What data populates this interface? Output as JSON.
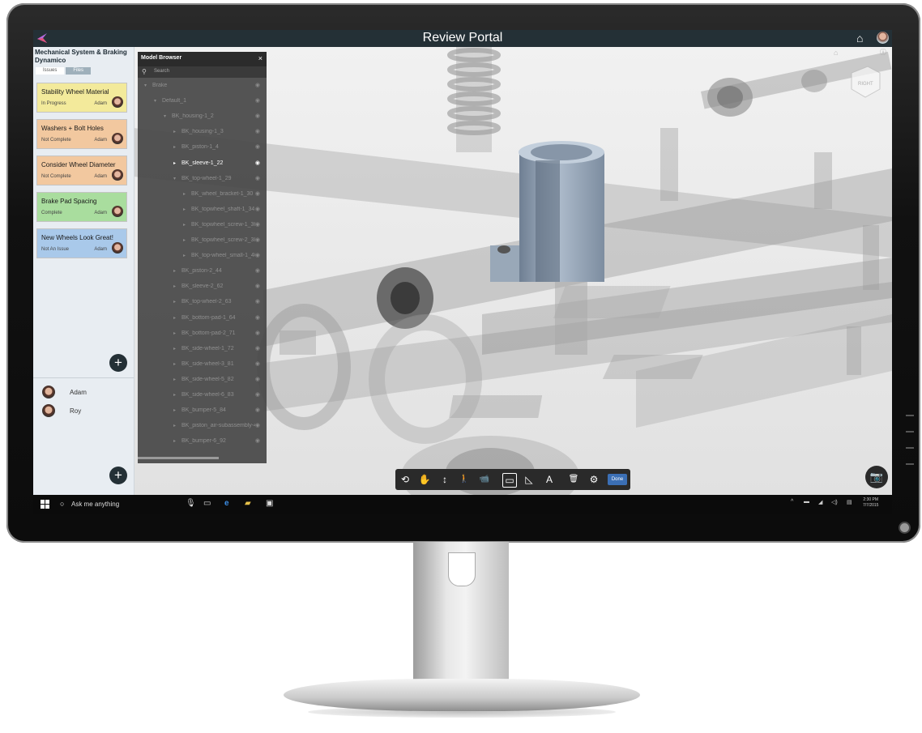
{
  "app": {
    "title": "Review Portal",
    "home_icon": "home-icon",
    "user_avatar": "user-avatar"
  },
  "project": {
    "title": "Mechanical System & Braking Dynamico",
    "tabs": [
      {
        "label": "Issues",
        "active": true
      },
      {
        "label": "Files",
        "active": false
      }
    ]
  },
  "issues": [
    {
      "title": "Stability Wheel Material",
      "status": "In Progress",
      "user": "Adam",
      "color": "#f3ea9b"
    },
    {
      "title": "Washers + Bolt Holes",
      "status": "Not Complete",
      "user": "Adam",
      "color": "#f2c89f"
    },
    {
      "title": "Consider Wheel Diameter",
      "status": "Not Complete",
      "user": "Adam",
      "color": "#f2c89f"
    },
    {
      "title": "Brake Pad Spacing",
      "status": "Complete",
      "user": "Adam",
      "color": "#a9dd9e"
    },
    {
      "title": "New Wheels Look Great!",
      "status": "Not An Issue",
      "user": "Adam",
      "color": "#a9c9ea"
    }
  ],
  "people": [
    {
      "name": "Adam"
    },
    {
      "name": "Roy"
    }
  ],
  "model_browser": {
    "title": "Model Browser",
    "close": "×",
    "search_placeholder": "Search",
    "rows": [
      {
        "label": "Brake",
        "level": 0,
        "arrow": "▾",
        "highlight": false
      },
      {
        "label": "Default_1",
        "level": 1,
        "arrow": "▾",
        "highlight": false
      },
      {
        "label": "BK_housing-1_2",
        "level": 2,
        "arrow": "▾",
        "highlight": false
      },
      {
        "label": "BK_housing-1_3",
        "level": 3,
        "arrow": "▸",
        "highlight": false
      },
      {
        "label": "BK_piston-1_4",
        "level": 3,
        "arrow": "▸",
        "highlight": false
      },
      {
        "label": "BK_sleeve-1_22",
        "level": 3,
        "arrow": "▸",
        "highlight": true
      },
      {
        "label": "BK_top-wheel-1_29",
        "level": 3,
        "arrow": "▾",
        "highlight": false
      },
      {
        "label": "BK_wheel_bracket-1_30",
        "level": 4,
        "arrow": "▸",
        "highlight": false
      },
      {
        "label": "BK_topwheel_shaft-1_34",
        "level": 4,
        "arrow": "▸",
        "highlight": false
      },
      {
        "label": "BK_topwheel_screw-1_36",
        "level": 4,
        "arrow": "▸",
        "highlight": false
      },
      {
        "label": "BK_topwheel_screw-2_38",
        "level": 4,
        "arrow": "▸",
        "highlight": false
      },
      {
        "label": "BK_top-wheel_small-1_40",
        "level": 4,
        "arrow": "▸",
        "highlight": false
      },
      {
        "label": "BK_piston-2_44",
        "level": 3,
        "arrow": "▸",
        "highlight": false
      },
      {
        "label": "BK_sleeve-2_62",
        "level": 3,
        "arrow": "▸",
        "highlight": false
      },
      {
        "label": "BK_top-wheel-2_63",
        "level": 3,
        "arrow": "▸",
        "highlight": false
      },
      {
        "label": "BK_bottom-pad-1_64",
        "level": 3,
        "arrow": "▸",
        "highlight": false
      },
      {
        "label": "BK_bottom-pad-2_71",
        "level": 3,
        "arrow": "▸",
        "highlight": false
      },
      {
        "label": "BK_side-wheel-1_72",
        "level": 3,
        "arrow": "▸",
        "highlight": false
      },
      {
        "label": "BK_side-wheel-3_81",
        "level": 3,
        "arrow": "▸",
        "highlight": false
      },
      {
        "label": "BK_side-wheel-5_82",
        "level": 3,
        "arrow": "▸",
        "highlight": false
      },
      {
        "label": "BK_side-wheel-6_83",
        "level": 3,
        "arrow": "▸",
        "highlight": false
      },
      {
        "label": "BK_bumper-5_84",
        "level": 3,
        "arrow": "▸",
        "highlight": false
      },
      {
        "label": "BK_piston_air-subassembly-4_91",
        "level": 3,
        "arrow": "▸",
        "highlight": false
      },
      {
        "label": "BK_bumper-6_92",
        "level": 3,
        "arrow": "▸",
        "highlight": false
      }
    ]
  },
  "viewcube": {
    "face_label": "RIGHT"
  },
  "toolbar": {
    "tools": [
      "orbit-icon",
      "pan-icon",
      "zoom-icon",
      "walk-icon",
      "camera-path-icon",
      "section-icon",
      "measure-icon",
      "markup-text-icon",
      "delete-icon",
      "settings-icon"
    ],
    "glyphs": [
      "⟲",
      "✋",
      "↕",
      "🚶",
      "📹",
      "▭",
      "◺",
      "A",
      "🗑",
      "⚙"
    ],
    "done_label": "Done"
  },
  "taskbar": {
    "search_text": "Ask me anything",
    "time": "2:30 PM",
    "date": "7/7/2015"
  }
}
